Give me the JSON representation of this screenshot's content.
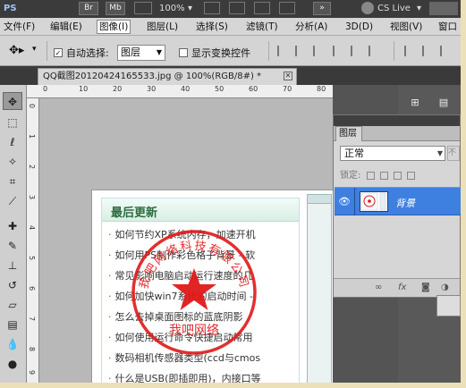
{
  "app": {
    "logo": "PS",
    "bridge": "Br",
    "minibridge": "Mb",
    "zoom": "100%",
    "cs_live": "CS Live"
  },
  "menubar": [
    {
      "label": "文件(F)"
    },
    {
      "label": "编辑(E)"
    },
    {
      "label": "图像(I)"
    },
    {
      "label": "图层(L)"
    },
    {
      "label": "选择(S)"
    },
    {
      "label": "滤镜(T)"
    },
    {
      "label": "分析(A)"
    },
    {
      "label": "3D(D)"
    },
    {
      "label": "视图(V)"
    },
    {
      "label": "窗口"
    }
  ],
  "options": {
    "auto_select_label": "自动选择:",
    "auto_select_checked": true,
    "auto_select_target": "图层",
    "show_transform_label": "显示变换控件",
    "show_transform_checked": false
  },
  "document": {
    "tab_title": "QQ截图20120424165533.jpg @ 100%(RGB/8#) *",
    "close_glyph": "✕"
  },
  "ruler": {
    "top_marks": [
      "0",
      "10",
      "20",
      "30",
      "40",
      "50",
      "60",
      "70",
      "80"
    ],
    "left_marks": [
      "0",
      "1",
      "2",
      "3",
      "4",
      "5",
      "6",
      "7",
      "8",
      "9"
    ]
  },
  "image": {
    "panel_title": "最后更新",
    "articles": [
      "如何节约XP系统内存，加速开机",
      "如何用PS制作彩色格子背景 - 软",
      "常见影响电脑启动运行速度的几",
      "如何加快win7系统的启动时间 -",
      "怎么去掉桌面图标的蓝底阴影",
      "如何使用运行命令快捷启动常用",
      "数码相机传感器类型(ccd与cmos",
      "什么是USB(即插即用)，内接口等"
    ],
    "stamp": {
      "arc_text": "我吧网络科技有限公司",
      "bottom_text": "我吧网络",
      "color": "#e01818"
    }
  },
  "layers_panel": {
    "tab_label": "图层",
    "blend_mode": "正常",
    "opacity_stub": "不",
    "lock_label": "锁定:",
    "layer_name": "背景",
    "footer_icons": [
      "link-icon",
      "fx-icon",
      "mask-icon",
      "adjustment-icon"
    ]
  },
  "colors": {
    "accent_selected_layer": "#3d80df",
    "stamp_red": "#e01818",
    "panel_title_green": "#2d6a3f"
  }
}
